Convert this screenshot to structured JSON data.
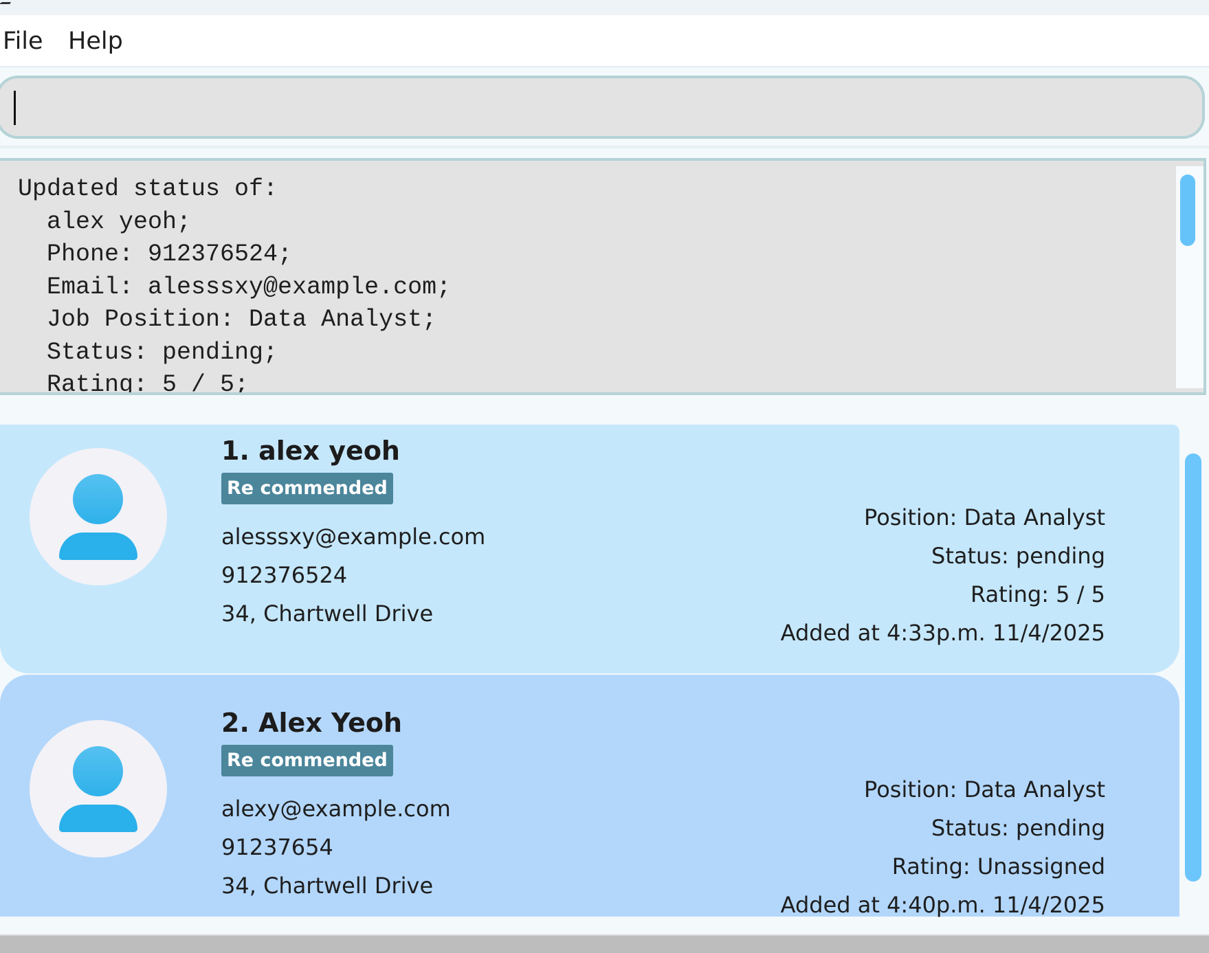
{
  "menu": {
    "file": "File",
    "help": "Help"
  },
  "command_box": {
    "value": ""
  },
  "result": {
    "lines": [
      "Updated status of:",
      "  alex yeoh;",
      "  Phone: 912376524;",
      "  Email: alesssxy@example.com;",
      "  Job Position: Data Analyst;",
      "  Status: pending;",
      "  Rating: 5 / 5;"
    ]
  },
  "candidates": [
    {
      "name": "1. alex yeoh",
      "tag": "Re commended",
      "email": "alesssxy@example.com",
      "phone": "912376524",
      "address": "34, Chartwell Drive",
      "position": "Position:  Data Analyst",
      "status": "Status:  pending",
      "rating": "Rating:  5 / 5",
      "added": "Added at 4:33p.m. 11/4/2025"
    },
    {
      "name": "2. Alex Yeoh",
      "tag": "Re commended",
      "email": "alexy@example.com",
      "phone": "91237654",
      "address": "34, Chartwell Drive",
      "position": "Position:  Data Analyst",
      "status": "Status:  pending",
      "rating": "Rating:  Unassigned",
      "added": "Added at 4:40p.m. 11/4/2025"
    }
  ],
  "colors": {
    "card1": "#c5e7fb",
    "card2": "#b3d7fb",
    "tag": "#4b869b",
    "scroll_thumb": "#66c3fa"
  },
  "icons": {
    "avatar": "person-icon"
  }
}
